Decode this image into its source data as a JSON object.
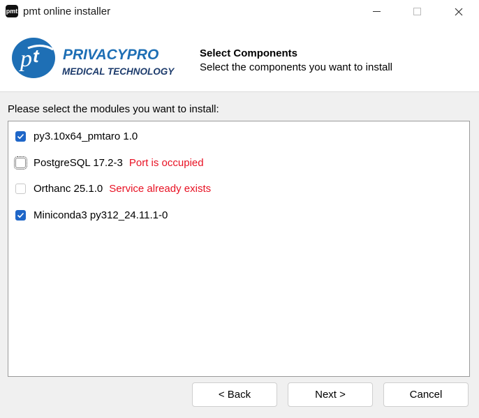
{
  "window": {
    "title": "pmt online installer",
    "app_icon_text": "pmt"
  },
  "header": {
    "logo_line1": "PRIVACYPRO",
    "logo_line2": "MEDICAL TECHNOLOGY",
    "title": "Select Components",
    "subtitle": "Select the components you want to install"
  },
  "instruction": "Please select the modules you want to install:",
  "modules": [
    {
      "label": "py3.10x64_pmtaro 1.0",
      "checked": true,
      "status": ""
    },
    {
      "label": "PostgreSQL 17.2-3",
      "checked": false,
      "status": "Port is occupied"
    },
    {
      "label": "Orthanc 25.1.0",
      "checked": false,
      "status": "Service already exists"
    },
    {
      "label": "Miniconda3 py312_24.11.1-0",
      "checked": true,
      "status": ""
    }
  ],
  "buttons": {
    "back": "< Back",
    "next": "Next >",
    "cancel": "Cancel"
  },
  "colors": {
    "accent": "#1e66c8",
    "logo_blue": "#1e6fb5",
    "logo_navy": "#1b3a6b",
    "error": "#e81123"
  }
}
